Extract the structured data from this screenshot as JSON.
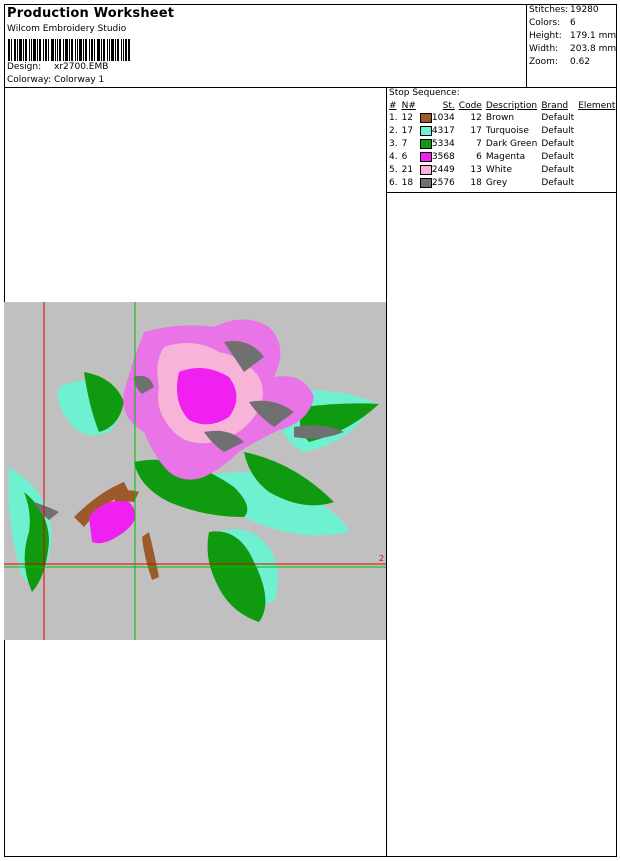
{
  "header": {
    "title": "Production Worksheet",
    "company": "Wilcom Embroidery Studio",
    "design_label": "Design:",
    "design_value": "xr2700.EMB",
    "colorway_label": "Colorway:",
    "colorway_value": "Colorway 1"
  },
  "stats": {
    "stitches_label": "Stitches:",
    "stitches_value": "19280",
    "colors_label": "Colors:",
    "colors_value": "6",
    "height_label": "Height:",
    "height_value": "179.1 mm",
    "width_label": "Width:",
    "width_value": "203.8 mm",
    "zoom_label": "Zoom:",
    "zoom_value": "0.62"
  },
  "stop_sequence": {
    "title": "Stop Sequence:",
    "headers": [
      "#",
      "N#",
      "St.",
      "Code",
      "Description",
      "Brand",
      "Element"
    ],
    "rows": [
      {
        "num": "1.",
        "n": "12",
        "color": "#9c5a2a",
        "st": "1034",
        "code": "12",
        "desc": "Brown",
        "brand": "Default"
      },
      {
        "num": "2.",
        "n": "17",
        "color": "#6ff0d0",
        "st": "4317",
        "code": "17",
        "desc": "Turquoise",
        "brand": "Default"
      },
      {
        "num": "3.",
        "n": "7",
        "color": "#109a10",
        "st": "5334",
        "code": "7",
        "desc": "Dark Green",
        "brand": "Default"
      },
      {
        "num": "4.",
        "n": "6",
        "color": "#f020f0",
        "st": "3568",
        "code": "6",
        "desc": "Magenta",
        "brand": "Default"
      },
      {
        "num": "5.",
        "n": "21",
        "color": "#f8b4d8",
        "st": "2449",
        "code": "13",
        "desc": "White",
        "brand": "Default"
      },
      {
        "num": "6.",
        "n": "18",
        "color": "#707070",
        "st": "2576",
        "code": "18",
        "desc": "Grey",
        "brand": "Default"
      }
    ]
  },
  "preview": {
    "background": "#c0c0c0",
    "guide_red": "#e00000",
    "guide_green": "#00c000",
    "marker_label": "2"
  }
}
